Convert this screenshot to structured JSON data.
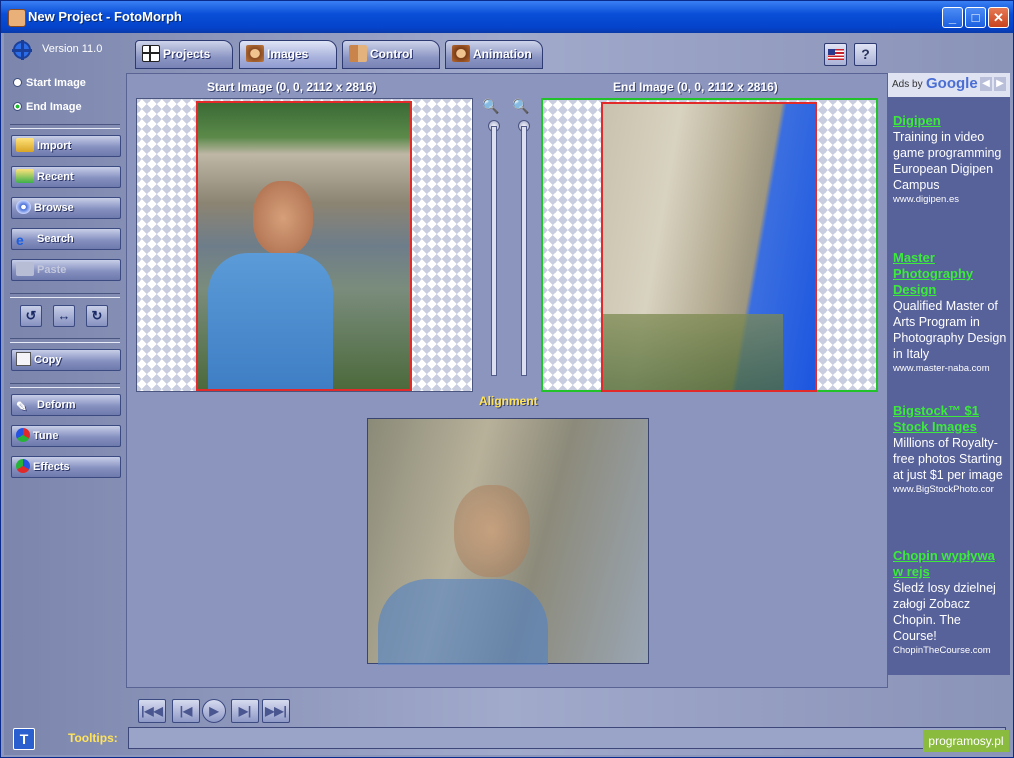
{
  "window": {
    "title": "New Project - FotoMorph",
    "minimize": "_",
    "maximize": "□",
    "close": "✕"
  },
  "app": {
    "version": "Version 11.0"
  },
  "selection": {
    "start_image": "Start Image",
    "end_image": "End Image",
    "selected": "end_image"
  },
  "sidebar": {
    "import": "Import",
    "recent": "Recent",
    "browse": "Browse",
    "search": "Search",
    "paste": "Paste",
    "copy": "Copy",
    "deform": "Deform",
    "tune": "Tune",
    "effects": "Effects",
    "rotate_left": "↺",
    "flip": "↔",
    "rotate_right": "↻"
  },
  "tabs": [
    {
      "label": "Projects",
      "active": false
    },
    {
      "label": "Images",
      "active": true
    },
    {
      "label": "Control",
      "active": false
    },
    {
      "label": "Animation",
      "active": false
    }
  ],
  "topbar": {
    "help": "?"
  },
  "images": {
    "start_caption": "Start Image (0, 0, 2112 x 2816)",
    "end_caption": "End Image (0, 0, 2112 x 2816)",
    "alignment_caption": "Alignment"
  },
  "ads": {
    "header_prefix": "Ads by",
    "header_brand": "Google",
    "items": [
      {
        "title": "Digipen",
        "body": "Training in video game programming European Digipen Campus",
        "url": "www.digipen.es"
      },
      {
        "title": "Master Photography Design",
        "body": "Qualified Master of Arts Program in Photography Design in Italy",
        "url": "www.master-naba.com"
      },
      {
        "title": "Bigstock™ $1 Stock Images",
        "body": "Millions of Royalty-free photos Starting at just $1 per image",
        "url": "www.BigStockPhoto.cor"
      },
      {
        "title": "Chopin wypływa w rejs",
        "body": "Śledź losy dzielnej załogi Zobacz Chopin. The Course!",
        "url": "ChopinTheCourse.com"
      }
    ]
  },
  "playback": {
    "first": "|◀◀",
    "prev": "|◀",
    "play": "▶",
    "next": "▶|",
    "last": "▶▶|"
  },
  "footer": {
    "tooltip_label": "Tooltips:",
    "tooltip_text": "",
    "tip_button": "T",
    "watermark": "programosy.pl"
  }
}
